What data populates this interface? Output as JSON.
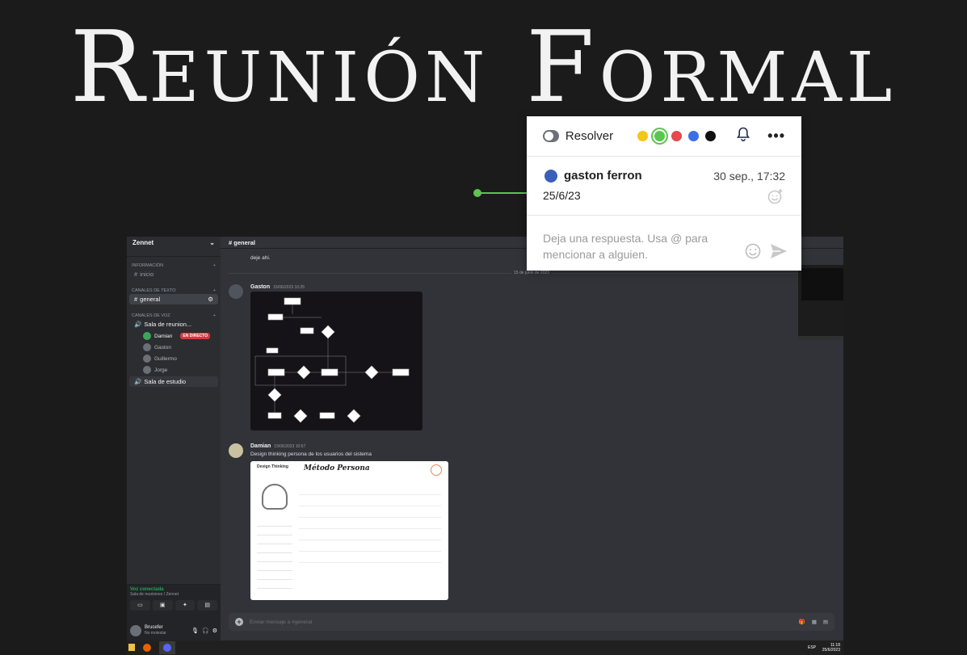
{
  "slide": {
    "title": "Reunión Formal"
  },
  "comment_popup": {
    "resolve_label": "Resolver",
    "colors": [
      "#f5c518",
      "#5ac54f",
      "#e5484d",
      "#3b6fe8",
      "#111111"
    ],
    "selected_color": "#5ac54f",
    "author": "gaston ferron",
    "time": "30 sep., 17:32",
    "text": "25/6/23",
    "reply_placeholder": "Deja una respuesta. Usa @ para mencionar a alguien."
  },
  "discord": {
    "server": "Zennet",
    "categories": {
      "info": "INFORMACIÓN",
      "text": "CANALES DE TEXTO",
      "voice": "CANALES DE VOZ"
    },
    "channels": {
      "inicio": "inicio",
      "general": "general"
    },
    "voice_channels": [
      "Sala de reunion...",
      "Sala de estudio"
    ],
    "voice_users": [
      "Damian",
      "Gaston",
      "Guillermo",
      "Jorge"
    ],
    "live_badge": "EN DIRECTO",
    "header_channel": "general",
    "top_text": "deje ahi.",
    "date_separator": "15 de junio de 2023",
    "messages": [
      {
        "author": "Gaston",
        "time": "15/06/2023 10:25"
      },
      {
        "author": "Damian",
        "time": "15/06/2023 10:57",
        "text": "Design thinking persona de los usuarios del sistema"
      }
    ],
    "persona_title": "Método Persona",
    "persona_brand": "Design Thinking",
    "voice_status": "Voz conectada",
    "voice_location": "Sala de reuniones / Zennet",
    "user": {
      "name": "Brucefer",
      "status": "No molestar"
    },
    "input_placeholder": "Enviar mensaje a #general",
    "taskbar": {
      "lang": "ESP",
      "time": "11:18",
      "date": "25/6/2023"
    }
  }
}
